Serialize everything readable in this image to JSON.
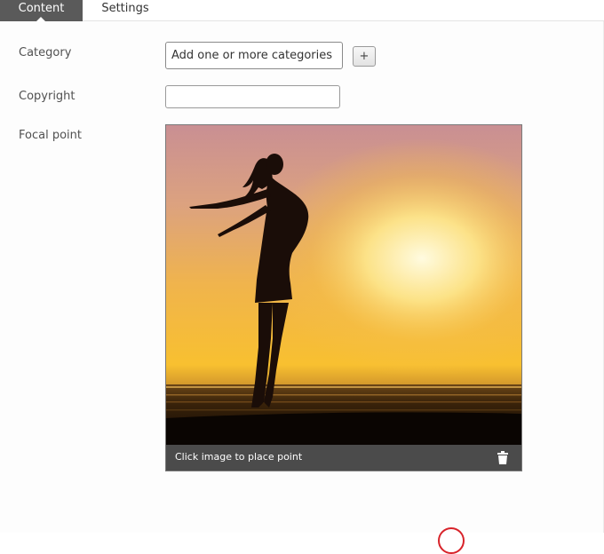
{
  "tabs": {
    "content_label": "Content",
    "settings_label": "Settings"
  },
  "form": {
    "category_label": "Category",
    "category_placeholder": "Add one or more categories",
    "add_button_label": "+",
    "copyright_label": "Copyright",
    "copyright_value": "",
    "focal_label": "Focal point"
  },
  "focal": {
    "hint": "Click image to place point",
    "delete_icon": "trash-icon"
  },
  "colors": {
    "active_tab": "#5a5a5a",
    "focal_bar": "#4b4b4b",
    "indicator": "#d8232a"
  }
}
